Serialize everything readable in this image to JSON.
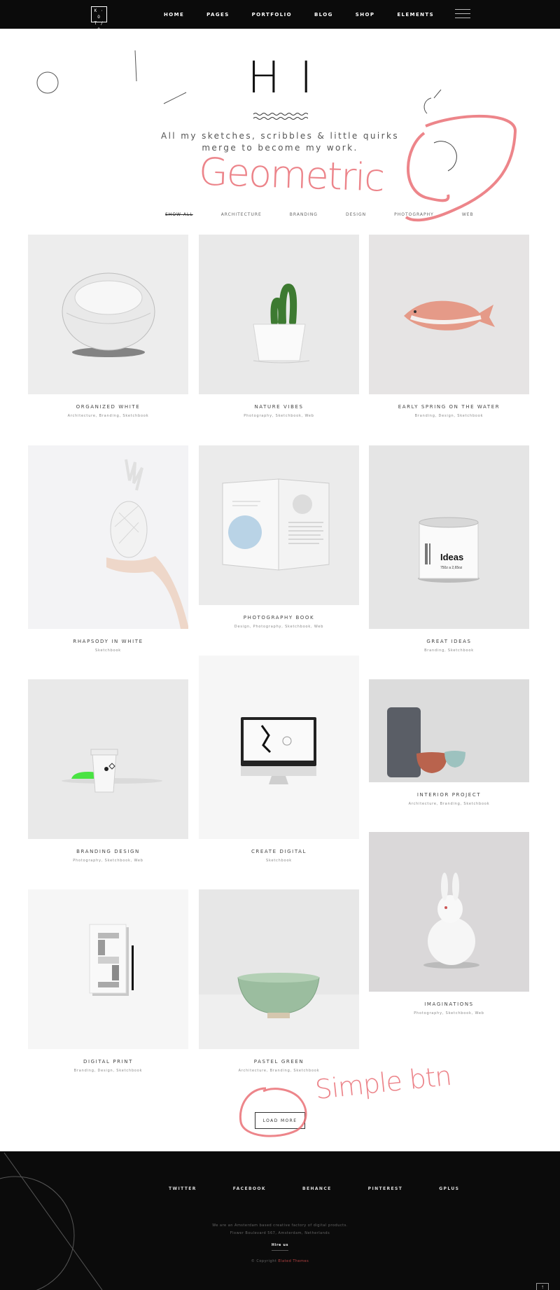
{
  "header": {
    "logo_lines": [
      "K · O",
      "T / O"
    ],
    "nav": [
      "HOME",
      "PAGES",
      "PORTFOLIO",
      "BLOG",
      "SHOP",
      "ELEMENTS"
    ]
  },
  "hero": {
    "title": "HI",
    "tagline_lines": [
      "All my sketches, scribbles & little quirks",
      "merge to become my work."
    ]
  },
  "filters": [
    "SHOW ALL",
    "ARCHITECTURE",
    "BRANDING",
    "DESIGN",
    "PHOTOGRAPHY",
    "WEB"
  ],
  "annotations": {
    "geometric": "Geometric",
    "simple_btn": "Simple btn"
  },
  "portfolio": [
    {
      "title": "ORGANIZED WHITE",
      "tags": "Architecture, Branding, Sketchbook",
      "image": "white-chair"
    },
    {
      "title": "NATURE VIBES",
      "tags": "Photography, Sketchbook, Web",
      "image": "cactus-pot"
    },
    {
      "title": "EARLY SPRING ON THE WATER",
      "tags": "Branding, Design, Sketchbook",
      "image": "red-fish"
    },
    {
      "title": "RHAPSODY IN WHITE",
      "tags": "Sketchbook",
      "image": "white-pineapple"
    },
    {
      "title": "PHOTOGRAPHY BOOK",
      "tags": "Design, Photography, Sketchbook, Web",
      "image": "open-book"
    },
    {
      "title": "GREAT IDEAS",
      "tags": "Branding, Sketchbook",
      "image": "ideas-tin",
      "can_label": "Ideas",
      "can_sub": "750z a 2,65oz"
    },
    {
      "title": "BRANDING DESIGN",
      "tags": "Photography, Sketchbook, Web",
      "image": "coffee-cup"
    },
    {
      "title": "CREATE DIGITAL",
      "tags": "Sketchbook",
      "image": "imac"
    },
    {
      "title": "INTERIOR PROJECT",
      "tags": "Architecture, Branding, Sketchbook",
      "image": "vases"
    },
    {
      "title": "DIGITAL PRINT",
      "tags": "Branding, Design, Sketchbook",
      "image": "print-s"
    },
    {
      "title": "PASTEL GREEN",
      "tags": "Architecture, Branding, Sketchbook",
      "image": "green-bowl"
    },
    {
      "title": "IMAGINATIONS",
      "tags": "Photography, Sketchbook, Web",
      "image": "white-rabbit"
    }
  ],
  "load_more": "LOAD MORE",
  "footer": {
    "social": [
      "TWITTER",
      "FACEBOOK",
      "BEHANCE",
      "PINTEREST",
      "GPLUS"
    ],
    "about_lines": [
      "We are an Amsterdam based creative factory of digital products.",
      "Flower Boulevard 567, Amsterdam, Netherlands"
    ],
    "hire_us": "Hire us",
    "copyright_prefix": "© Copyright",
    "copyright_brand": "Elated Themes",
    "back_to_top": "↑"
  },
  "colors": {
    "dark": "#0b0b0b",
    "annotation": "#e8666d"
  }
}
